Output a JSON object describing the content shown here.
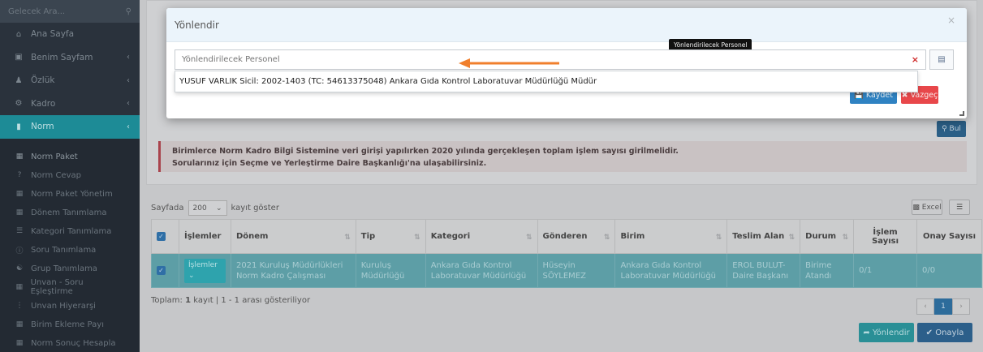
{
  "sidebar": {
    "search_placeholder": "Gelecek Ara...",
    "items": [
      {
        "label": "Ana Sayfa",
        "icon": "home-icon"
      },
      {
        "label": "Benim Sayfam",
        "icon": "page-icon"
      },
      {
        "label": "Özlük",
        "icon": "user-icon"
      },
      {
        "label": "Kadro",
        "icon": "gear-icon"
      },
      {
        "label": "Norm",
        "icon": "chart-icon"
      }
    ],
    "subitems": [
      "Norm Paket",
      "Norm Cevap",
      "Norm Paket Yönetim",
      "Dönem Tanımlama",
      "Kategori Tanımlama",
      "Soru Tanımlama",
      "Grup Tanımlama",
      "Unvan - Soru Eşleştirme",
      "Unvan Hiyerarşi",
      "Birim Ekleme Payı",
      "Norm Sonuç Hesapla"
    ]
  },
  "modal": {
    "title": "Yönlendir",
    "close": "×",
    "tooltip": "Yönlendirilecek Personel",
    "input_placeholder": "Yönlendirilecek Personel",
    "clear": "×",
    "dropdown_option": "YUSUF VARLIK Sicil: 2002-1403 (TC: 54613375048) Ankara Gıda Kontrol Laboratuvar Müdürlüğü Müdür",
    "save_label": "Kaydet",
    "cancel_label": "Vazgeç"
  },
  "main": {
    "search_button": "Bul",
    "notice_line1": "Birimlerce Norm Kadro Bilgi Sistemine veri girişi yapılırken 2020 yılında gerçekleşen toplam işlem sayısı girilmelidir.",
    "notice_line2": "Sorularınız için Seçme ve Yerleştirme Daire Başkanlığı'na ulaşabilirsiniz.",
    "length_prefix": "Sayfada",
    "length_value": "200",
    "length_suffix": "kayıt göster",
    "excel_label": "Excel",
    "columns": [
      "İşlemler",
      "Dönem",
      "Tip",
      "Kategori",
      "Gönderen",
      "Birim",
      "Teslim Alan",
      "Durum",
      "İşlem Sayısı",
      "Onay Sayısı"
    ],
    "row": {
      "islemler": "İşlemler",
      "donem": "2021 Kuruluş Müdürlükleri Norm Kadro Çalışması",
      "tip": "Kuruluş Müdürlüğü",
      "kategori": "Ankara Gıda Kontrol Laboratuvar Müdürlüğü",
      "gonderen": "Hüseyin SÖYLEMEZ",
      "birim": "Ankara Gıda Kontrol Laboratuvar Müdürlüğü",
      "teslim_alan": "EROL BULUT-Daire Başkanı",
      "durum": "Birime Atandı",
      "islem_sayisi": "0/1",
      "onay_sayisi": "0/0"
    },
    "footer_prefix": "Toplam:",
    "footer_count": "1",
    "footer_rest": "kayıt | 1 - 1 arası gösteriliyor",
    "page_prev": "‹",
    "page_current": "1",
    "page_next": "›",
    "redirect_label": "Yönlendir",
    "approve_label": "Onayla"
  },
  "colors": {
    "accent": "#1d8b96",
    "arrow": "#f07f2c",
    "primary": "#2f82c2",
    "danger": "#e8474a"
  }
}
